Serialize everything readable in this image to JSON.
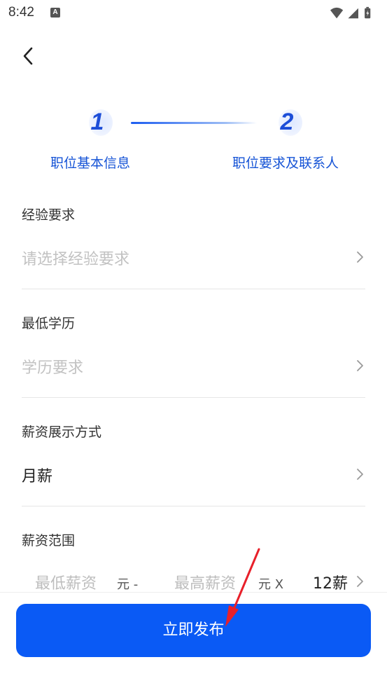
{
  "status_bar": {
    "time": "8:42",
    "notification_glyph": "A"
  },
  "stepper": {
    "steps": [
      {
        "number": "1",
        "label": "职位基本信息"
      },
      {
        "number": "2",
        "label": "职位要求及联系人"
      }
    ],
    "connector_color": "#1d5df0"
  },
  "form": {
    "experience": {
      "label": "经验要求",
      "placeholder": "请选择经验要求"
    },
    "education": {
      "label": "最低学历",
      "placeholder": "学历要求"
    },
    "salary_display": {
      "label": "薪资展示方式",
      "value": "月薪"
    },
    "salary_range": {
      "label": "薪资范围",
      "min_placeholder": "最低薪资",
      "min_unit": "元 -",
      "max_placeholder": "最高薪资",
      "max_unit": "元 X",
      "months": "12薪"
    }
  },
  "footer": {
    "publish_label": "立即发布",
    "button_color": "#0a5af5"
  },
  "annotation": {
    "arrow_color": "#e8202a"
  },
  "icons": [
    "back-arrow-icon",
    "wifi-icon",
    "cell-signal-icon",
    "battery-icon",
    "chevron-right-icon"
  ]
}
